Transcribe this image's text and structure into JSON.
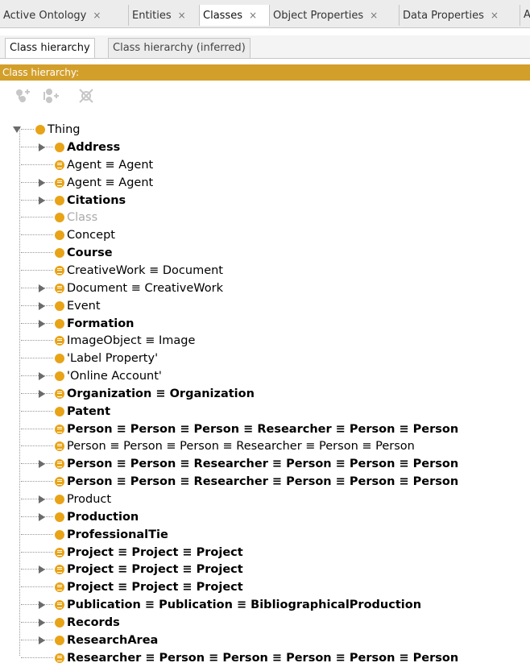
{
  "colors": {
    "header": "#d39f2b",
    "bullet": "#e8a317",
    "tab_bg": "#ececec"
  },
  "tabs": [
    {
      "label": "Active Ontology",
      "close": "×"
    },
    {
      "label": "Entities",
      "close": "×"
    },
    {
      "label": "Classes",
      "close": "×"
    },
    {
      "label": "Object Properties",
      "close": "×"
    },
    {
      "label": "Data Properties",
      "close": "×"
    },
    {
      "label": "A",
      "close": ""
    }
  ],
  "subtabs": [
    {
      "label": "Class hierarchy"
    },
    {
      "label": "Class hierarchy (inferred)"
    }
  ],
  "header": {
    "title": "Class hierarchy:"
  },
  "toolbar": {
    "buttons": [
      {
        "icon": "add-subclass-icon"
      },
      {
        "icon": "add-sibling-class-icon"
      },
      {
        "icon": "delete-class-icon"
      }
    ]
  },
  "tree": {
    "root": {
      "label": "Thing",
      "icon": "class-bullet-icon"
    },
    "items": [
      {
        "label": "Address",
        "style": "bold",
        "expandable": true,
        "equivalent": false
      },
      {
        "label": "Agent ≡ Agent",
        "style": "normal",
        "expandable": false,
        "equivalent": true
      },
      {
        "label": "Agent ≡ Agent",
        "style": "normal",
        "expandable": true,
        "equivalent": true
      },
      {
        "label": "Citations",
        "style": "bold",
        "expandable": true,
        "equivalent": false
      },
      {
        "label": "Class",
        "style": "grey",
        "expandable": false,
        "equivalent": false
      },
      {
        "label": "Concept",
        "style": "normal",
        "expandable": false,
        "equivalent": false
      },
      {
        "label": "Course",
        "style": "bold",
        "expandable": false,
        "equivalent": false
      },
      {
        "label": "CreativeWork ≡ Document",
        "style": "normal",
        "expandable": false,
        "equivalent": true
      },
      {
        "label": "Document ≡ CreativeWork",
        "style": "normal",
        "expandable": true,
        "equivalent": true
      },
      {
        "label": "Event",
        "style": "normal",
        "expandable": true,
        "equivalent": false
      },
      {
        "label": "Formation",
        "style": "bold",
        "expandable": true,
        "equivalent": false
      },
      {
        "label": "ImageObject ≡ Image",
        "style": "normal",
        "expandable": false,
        "equivalent": true
      },
      {
        "label": "'Label Property'",
        "style": "normal",
        "expandable": false,
        "equivalent": false
      },
      {
        "label": "'Online Account'",
        "style": "normal",
        "expandable": true,
        "equivalent": false
      },
      {
        "label": "Organization ≡ Organization",
        "style": "bold",
        "expandable": true,
        "equivalent": true
      },
      {
        "label": "Patent",
        "style": "bold",
        "expandable": false,
        "equivalent": false
      },
      {
        "label": "Person ≡ Person ≡ Person ≡ Researcher ≡ Person ≡ Person",
        "style": "bold",
        "expandable": false,
        "equivalent": true
      },
      {
        "label": "Person ≡ Person ≡ Person ≡ Researcher ≡ Person ≡ Person",
        "style": "normal",
        "expandable": false,
        "equivalent": true
      },
      {
        "label": "Person ≡ Person ≡ Researcher ≡ Person ≡ Person ≡ Person",
        "style": "bold",
        "expandable": true,
        "equivalent": true
      },
      {
        "label": "Person ≡ Person ≡ Researcher ≡ Person ≡ Person ≡ Person",
        "style": "bold",
        "expandable": false,
        "equivalent": true
      },
      {
        "label": "Product",
        "style": "normal",
        "expandable": true,
        "equivalent": false
      },
      {
        "label": "Production",
        "style": "bold",
        "expandable": true,
        "equivalent": false
      },
      {
        "label": "ProfessionalTie",
        "style": "bold",
        "expandable": false,
        "equivalent": false
      },
      {
        "label": "Project ≡ Project ≡ Project",
        "style": "bold",
        "expandable": false,
        "equivalent": true
      },
      {
        "label": "Project ≡ Project ≡ Project",
        "style": "bold",
        "expandable": true,
        "equivalent": true
      },
      {
        "label": "Project ≡ Project ≡ Project",
        "style": "bold",
        "expandable": false,
        "equivalent": true
      },
      {
        "label": "Publication ≡ Publication ≡ BibliographicalProduction",
        "style": "bold",
        "expandable": true,
        "equivalent": true
      },
      {
        "label": "Records",
        "style": "bold",
        "expandable": true,
        "equivalent": false
      },
      {
        "label": "ResearchArea",
        "style": "bold",
        "expandable": true,
        "equivalent": false
      },
      {
        "label": "Researcher ≡ Person ≡ Person ≡ Person ≡ Person ≡ Person",
        "style": "bold",
        "expandable": false,
        "equivalent": true
      }
    ]
  }
}
